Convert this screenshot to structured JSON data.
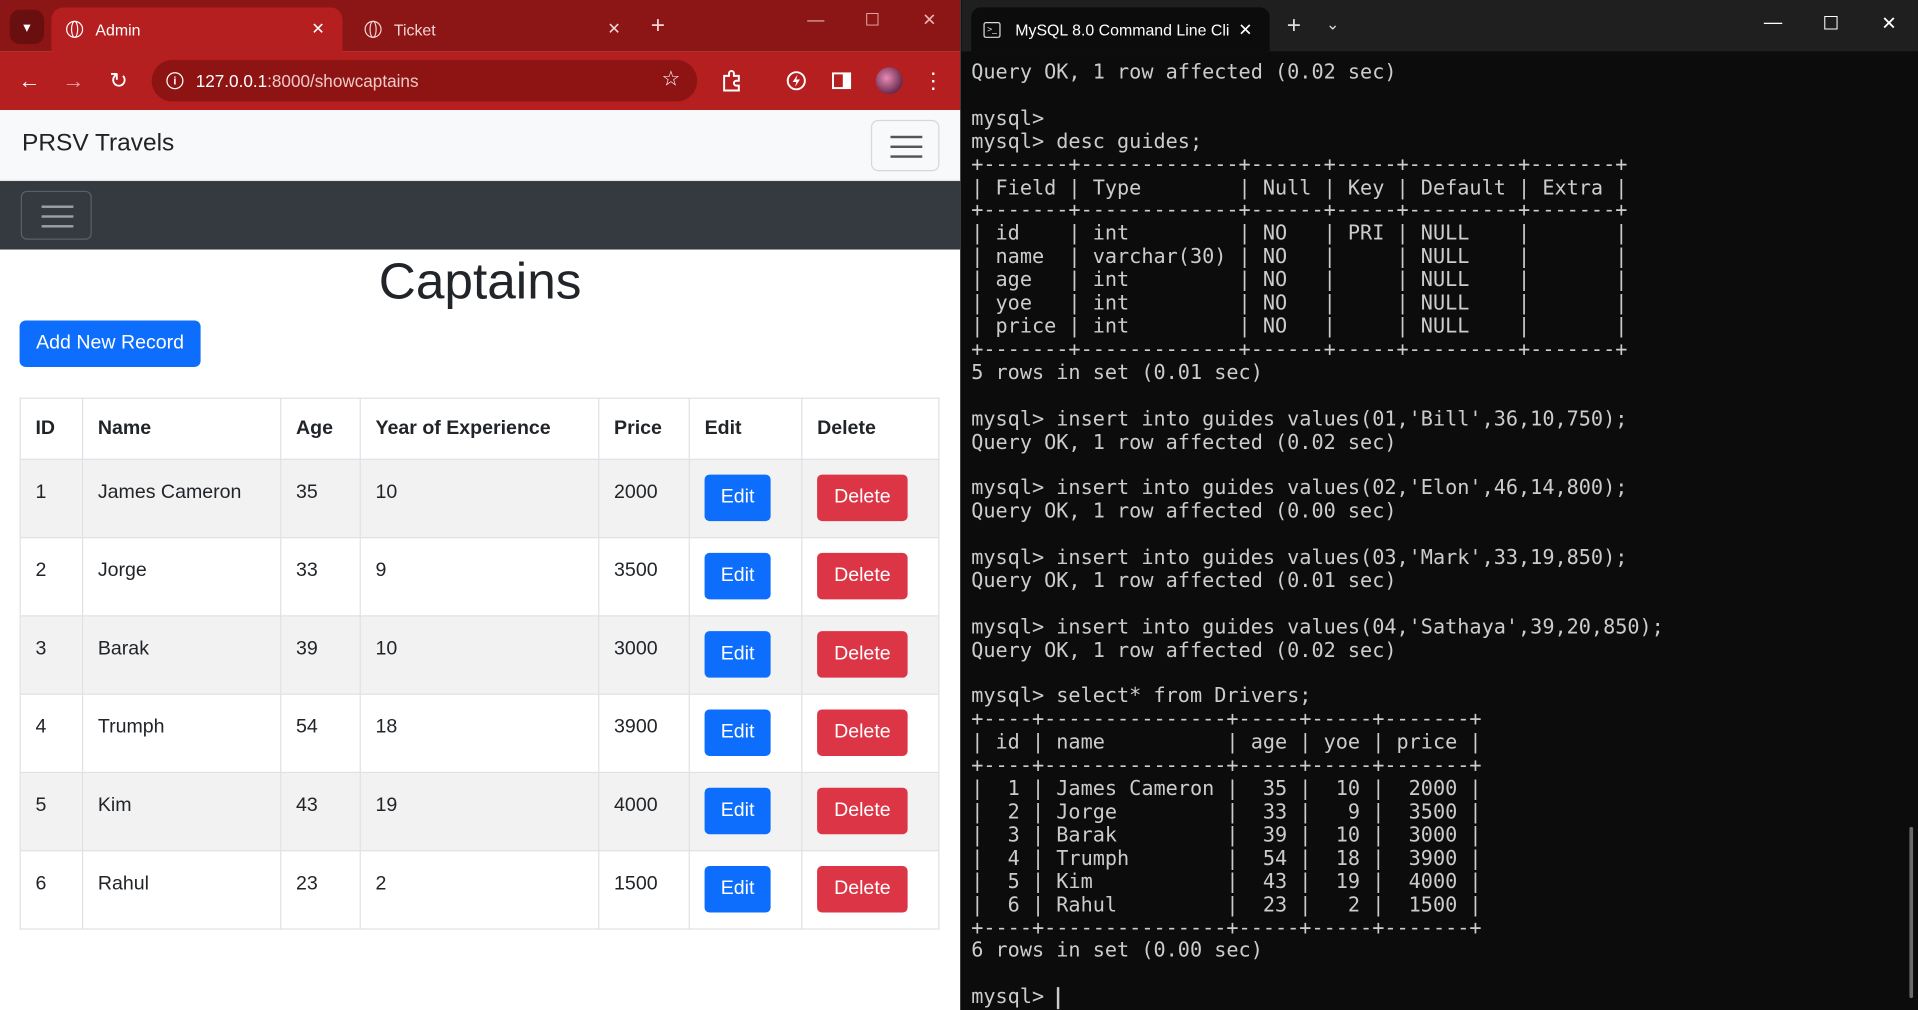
{
  "browser": {
    "tabs": [
      {
        "title": "Admin",
        "active": true
      },
      {
        "title": "Ticket",
        "active": false
      }
    ],
    "url_host": "127.0.0.1",
    "url_path": ":8000/showcaptains",
    "accent": "#b51f1f"
  },
  "page": {
    "brand": "PRSV Travels",
    "title": "Captains",
    "add_button": "Add New Record",
    "columns": [
      "ID",
      "Name",
      "Age",
      "Year of Experience",
      "Price",
      "Edit",
      "Delete"
    ],
    "rows": [
      {
        "id": "1",
        "name": "James Cameron",
        "age": "35",
        "yoe": "10",
        "price": "2000"
      },
      {
        "id": "2",
        "name": "Jorge",
        "age": "33",
        "yoe": "9",
        "price": "3500"
      },
      {
        "id": "3",
        "name": "Barak",
        "age": "39",
        "yoe": "10",
        "price": "3000"
      },
      {
        "id": "4",
        "name": "Trumph",
        "age": "54",
        "yoe": "18",
        "price": "3900"
      },
      {
        "id": "5",
        "name": "Kim",
        "age": "43",
        "yoe": "19",
        "price": "4000"
      },
      {
        "id": "6",
        "name": "Rahul",
        "age": "23",
        "yoe": "2",
        "price": "1500"
      }
    ],
    "edit_label": "Edit",
    "delete_label": "Delete",
    "colors": {
      "primary": "#0d6efd",
      "danger": "#dc3545"
    }
  },
  "terminal": {
    "tab_title": "MySQL 8.0 Command Line Cli",
    "lines": [
      "Query OK, 1 row affected (0.02 sec)",
      "",
      "mysql>",
      "mysql> desc guides;",
      "+-------+-------------+------+-----+---------+-------+",
      "| Field | Type        | Null | Key | Default | Extra |",
      "+-------+-------------+------+-----+---------+-------+",
      "| id    | int         | NO   | PRI | NULL    |       |",
      "| name  | varchar(30) | NO   |     | NULL    |       |",
      "| age   | int         | NO   |     | NULL    |       |",
      "| yoe   | int         | NO   |     | NULL    |       |",
      "| price | int         | NO   |     | NULL    |       |",
      "+-------+-------------+------+-----+---------+-------+",
      "5 rows in set (0.01 sec)",
      "",
      "mysql> insert into guides values(01,'Bill',36,10,750);",
      "Query OK, 1 row affected (0.02 sec)",
      "",
      "mysql> insert into guides values(02,'Elon',46,14,800);",
      "Query OK, 1 row affected (0.00 sec)",
      "",
      "mysql> insert into guides values(03,'Mark',33,19,850);",
      "Query OK, 1 row affected (0.01 sec)",
      "",
      "mysql> insert into guides values(04,'Sathaya',39,20,850);",
      "Query OK, 1 row affected (0.02 sec)",
      "",
      "mysql> select* from Drivers;",
      "+----+---------------+-----+-----+-------+",
      "| id | name          | age | yoe | price |",
      "+----+---------------+-----+-----+-------+",
      "|  1 | James Cameron |  35 |  10 |  2000 |",
      "|  2 | Jorge         |  33 |   9 |  3500 |",
      "|  3 | Barak         |  39 |  10 |  3000 |",
      "|  4 | Trumph        |  54 |  18 |  3900 |",
      "|  5 | Kim           |  43 |  19 |  4000 |",
      "|  6 | Rahul         |  23 |   2 |  1500 |",
      "+----+---------------+-----+-----+-------+",
      "6 rows in set (0.00 sec)",
      ""
    ],
    "prompt": "mysql> "
  }
}
